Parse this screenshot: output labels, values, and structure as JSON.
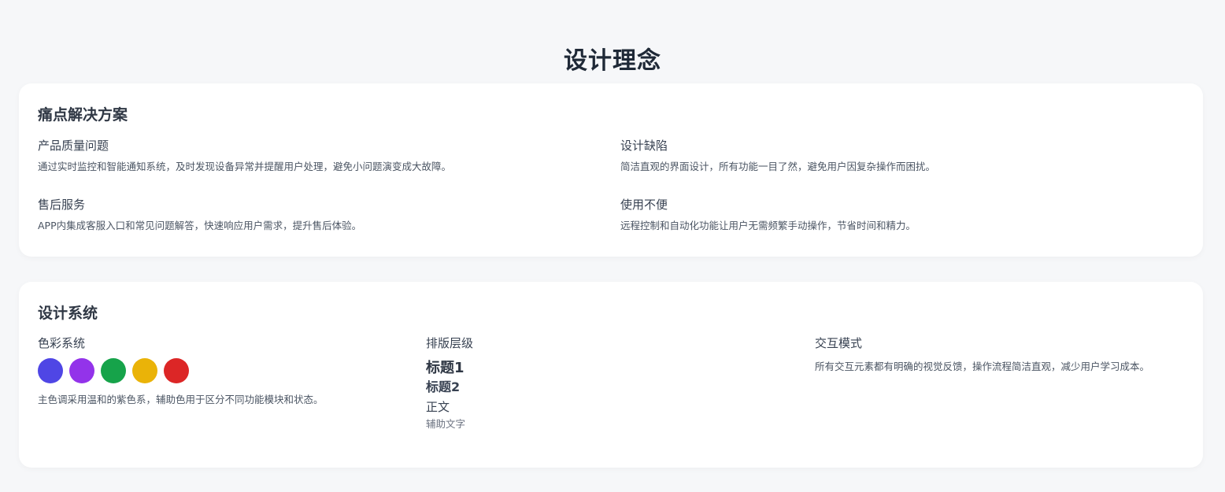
{
  "page": {
    "title": "设计理念"
  },
  "pain_points": {
    "title": "痛点解决方案",
    "items": [
      {
        "title": "产品质量问题",
        "description": "通过实时监控和智能通知系统，及时发现设备异常并提醒用户处理，避免小问题演变成大故障。"
      },
      {
        "title": "设计缺陷",
        "description": "简洁直观的界面设计，所有功能一目了然，避免用户因复杂操作而困扰。"
      },
      {
        "title": "售后服务",
        "description": "APP内集成客服入口和常见问题解答，快速响应用户需求，提升售后体验。"
      },
      {
        "title": "使用不便",
        "description": "远程控制和自动化功能让用户无需频繁手动操作，节省时间和精力。"
      }
    ]
  },
  "design_system": {
    "title": "设计系统",
    "color": {
      "title": "色彩系统",
      "swatches": [
        "#4f46e5",
        "#9333ea",
        "#16a34a",
        "#eab308",
        "#dc2626"
      ],
      "description": "主色调采用温和的紫色系，辅助色用于区分不同功能模块和状态。"
    },
    "typography": {
      "title": "排版层级",
      "heading1": "标题1",
      "heading2": "标题2",
      "body": "正文",
      "auxiliary": "辅助文字"
    },
    "interaction": {
      "title": "交互模式",
      "description": "所有交互元素都有明确的视觉反馈，操作流程简洁直观，减少用户学习成本。"
    }
  }
}
